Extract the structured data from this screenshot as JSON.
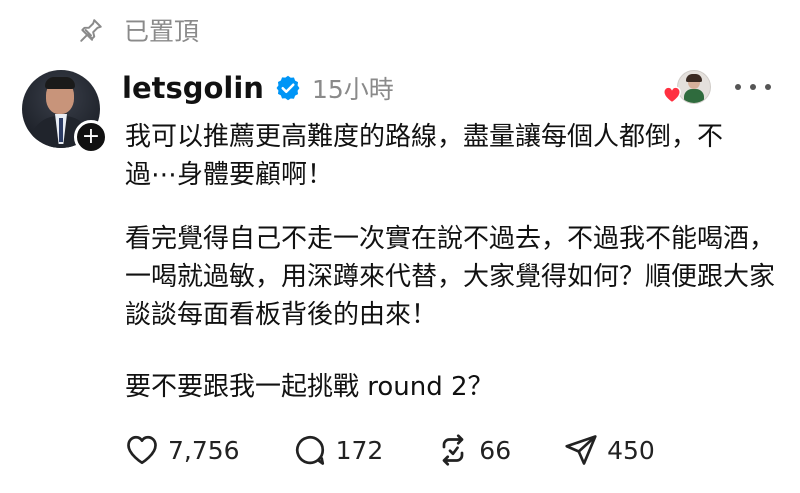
{
  "pinned": {
    "label": "已置頂",
    "icon": "pin-icon"
  },
  "post": {
    "author": {
      "username": "letsgolin",
      "verified": true,
      "verified_color": "#0095f6",
      "avatar": "avatar"
    },
    "time": "15小時",
    "reactor": {
      "avatar": "mini-avatar",
      "badge": "heart-icon",
      "badge_color": "#ff3040"
    },
    "more_menu": "more-icon",
    "paragraphs": [
      "我可以推薦更高難度的路線，盡量讓每個人都倒，不過⋯身體要顧啊！",
      "看完覺得自己不走一次實在說不過去，不過我不能喝酒，一喝就過敏，用深蹲來代替，大家覺得如何？順便跟大家談談每面看板背後的由來！",
      "要不要跟我一起挑戰 round 2？"
    ],
    "actions": {
      "like": {
        "icon": "heart-outline-icon",
        "count": "7,756"
      },
      "reply": {
        "icon": "comment-icon",
        "count": "172"
      },
      "repost": {
        "icon": "repost-icon",
        "count": "66"
      },
      "share": {
        "icon": "send-icon",
        "count": "450"
      }
    }
  }
}
